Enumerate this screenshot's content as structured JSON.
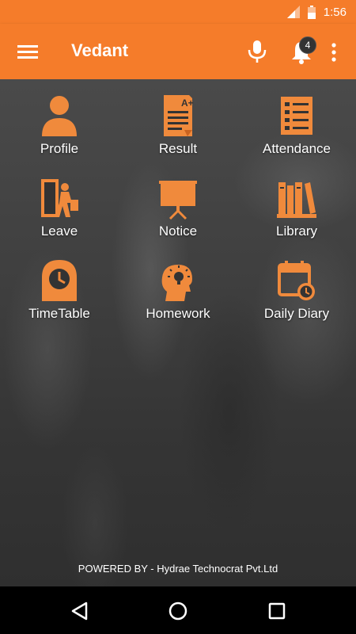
{
  "status_bar": {
    "time": "1:56"
  },
  "app_bar": {
    "title": "Vedant",
    "notification_count": "4"
  },
  "menu": {
    "items": [
      {
        "label": "Profile",
        "icon": "profile-icon"
      },
      {
        "label": "Result",
        "icon": "result-icon"
      },
      {
        "label": "Attendance",
        "icon": "attendance-icon"
      },
      {
        "label": "Leave",
        "icon": "leave-icon"
      },
      {
        "label": "Notice",
        "icon": "notice-icon"
      },
      {
        "label": "Library",
        "icon": "library-icon"
      },
      {
        "label": "TimeTable",
        "icon": "timetable-icon"
      },
      {
        "label": "Homework",
        "icon": "homework-icon"
      },
      {
        "label": "Daily Diary",
        "icon": "daily-diary-icon"
      }
    ]
  },
  "footer": {
    "text": "POWERED BY - Hydrae Technocrat Pvt.Ltd"
  },
  "colors": {
    "accent": "#f57c2a",
    "icon": "#f08a3c",
    "nav": "#000000"
  }
}
